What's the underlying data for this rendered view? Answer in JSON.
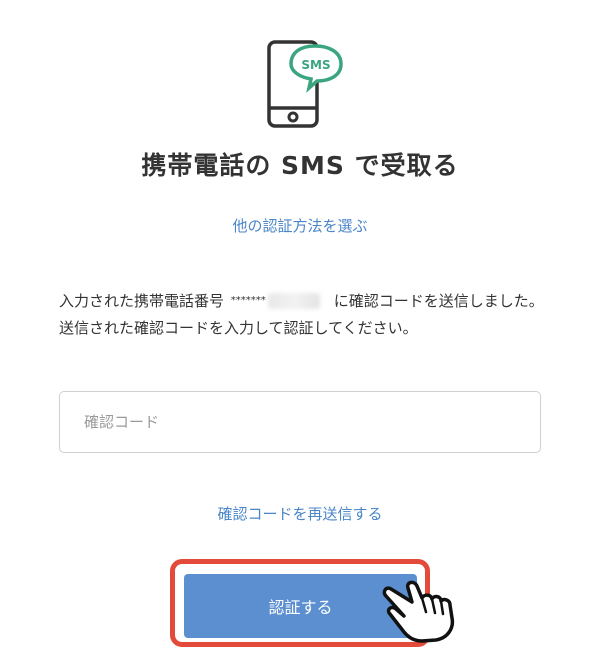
{
  "header": {
    "icon": "phone-sms-icon",
    "sms_badge": "SMS",
    "title": "携帯電話の SMS で受取る"
  },
  "links": {
    "alternate_method": "他の認証方法を選ぶ",
    "resend": "確認コードを再送信する"
  },
  "message": {
    "line1_before": "入力された携帯電話番号",
    "masked_number": "*******",
    "line1_after": "に確認コードを送信しました。",
    "line2": "送信された確認コードを入力して認証してください。"
  },
  "form": {
    "code_placeholder": "確認コード",
    "code_value": "",
    "submit_label": "認証する"
  },
  "colors": {
    "accent": "#4a86c8",
    "button": "#5b8fd0",
    "highlight": "#e34a3a",
    "sms_green": "#3aa57f"
  }
}
